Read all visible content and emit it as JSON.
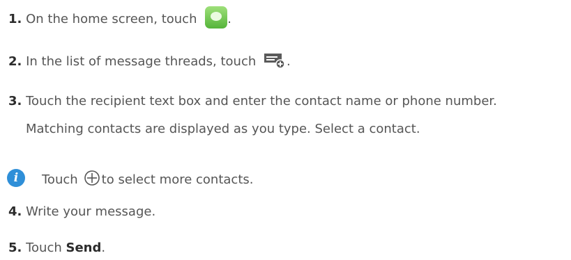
{
  "steps": [
    {
      "num": "1.",
      "text": "On the home screen, touch ",
      "icon": "messaging-app-icon",
      "after": "."
    },
    {
      "num": "2.",
      "text": "In the list of message threads, touch ",
      "icon": "new-message-icon",
      "after": "."
    },
    {
      "num": "3.",
      "text": "Touch the recipient text box and enter the contact name or phone number.",
      "text2": "Matching contacts are displayed as you type. Select a contact."
    },
    {
      "num": "4.",
      "text": "Write your message."
    },
    {
      "num": "5.",
      "text": "Touch ",
      "bold": "Send",
      "after": "."
    }
  ],
  "note": {
    "icon": "info-icon",
    "glyph": "i",
    "before": "Touch",
    "plus_icon": "plus-circle-icon",
    "after": "to select more contacts."
  },
  "colors": {
    "accent_blue": "#2f8fd8",
    "app_green": "#55b43a",
    "text": "#555555"
  }
}
